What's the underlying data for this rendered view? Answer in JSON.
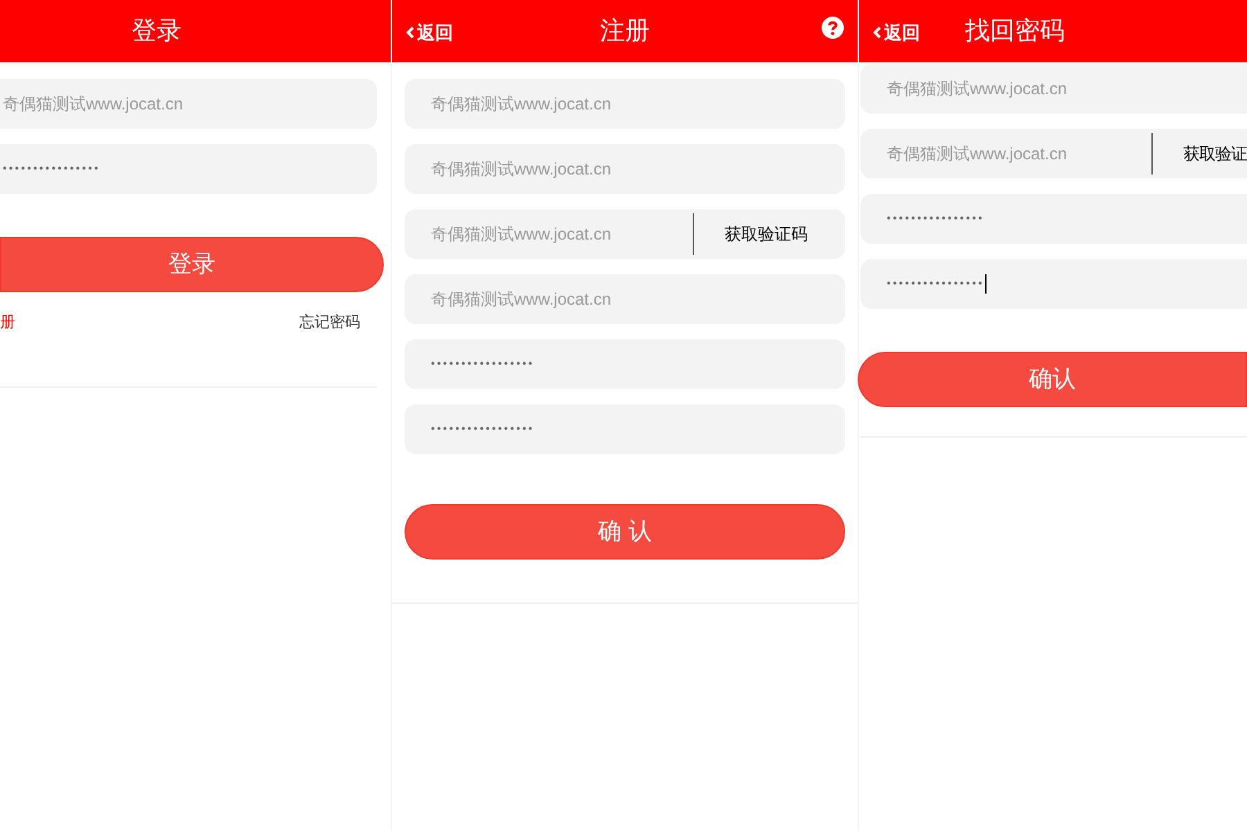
{
  "screens": [
    {
      "header": {
        "title": "登录"
      },
      "fields": [
        {
          "kind": "text",
          "placeholder": "奇偶猫测试www.jocat.cn"
        },
        {
          "kind": "password",
          "value": "••••••••••••••••"
        }
      ],
      "submit": "登录",
      "links": [
        {
          "label": "册",
          "kind": "accent"
        },
        {
          "label": "忘记密码",
          "kind": "plain"
        }
      ]
    },
    {
      "header": {
        "back": "返回",
        "title": "注册",
        "help": true
      },
      "fields": [
        {
          "kind": "text",
          "placeholder": "奇偶猫测试www.jocat.cn"
        },
        {
          "kind": "text",
          "placeholder": "奇偶猫测试www.jocat.cn"
        },
        {
          "kind": "code",
          "placeholder": "奇偶猫测试www.jocat.cn",
          "button": "获取验证码"
        },
        {
          "kind": "text",
          "placeholder": "奇偶猫测试www.jocat.cn"
        },
        {
          "kind": "password",
          "value": "•••••••••••••••••"
        },
        {
          "kind": "password",
          "value": "•••••••••••••••••"
        }
      ],
      "submit": "确 认"
    },
    {
      "header": {
        "back": "返回",
        "title": "找回密码",
        "help": false
      },
      "fields": [
        {
          "kind": "text",
          "placeholder": "奇偶猫测试www.jocat.cn"
        },
        {
          "kind": "code",
          "placeholder": "奇偶猫测试www.jocat.cn",
          "button": "获取验证"
        },
        {
          "kind": "password",
          "value": "••••••••••••••••",
          "focused": false
        },
        {
          "kind": "password",
          "value": "••••••••••••••••",
          "focused": true
        }
      ],
      "submit": "确认"
    }
  ]
}
